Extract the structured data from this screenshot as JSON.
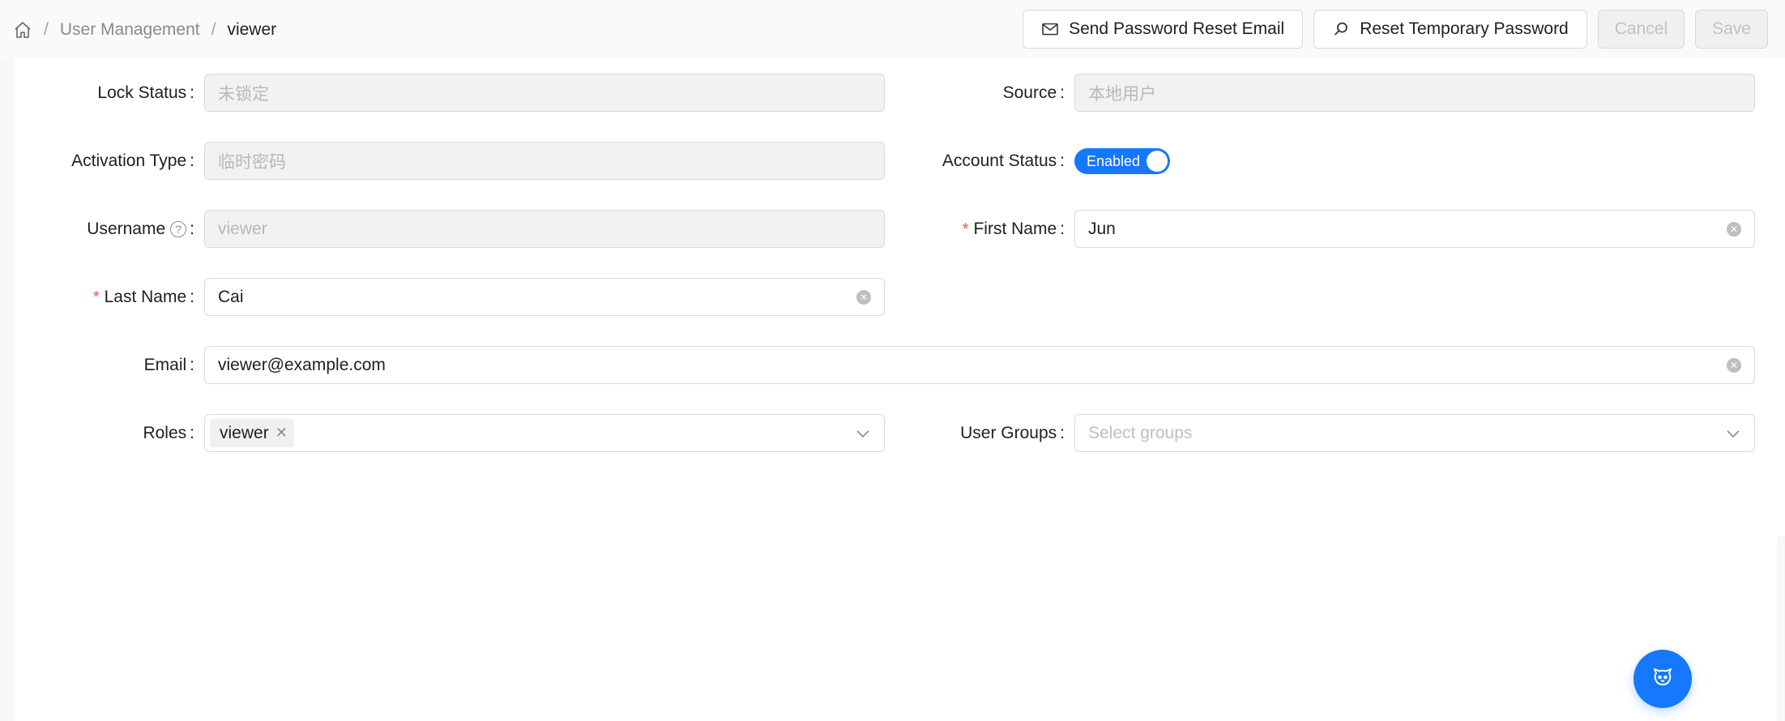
{
  "breadcrumb": {
    "items": [
      "User Management",
      "viewer"
    ]
  },
  "toolbar": {
    "send_reset_label": "Send Password Reset Email",
    "reset_temp_label": "Reset Temporary Password",
    "cancel_label": "Cancel",
    "save_label": "Save"
  },
  "form": {
    "lock_status": {
      "label": "Lock Status",
      "value": "未锁定"
    },
    "source": {
      "label": "Source",
      "value": "本地用户"
    },
    "activation_type": {
      "label": "Activation Type",
      "value": "临时密码"
    },
    "account_status": {
      "label": "Account Status",
      "value": "Enabled"
    },
    "username": {
      "label": "Username",
      "help": "?",
      "value": "viewer"
    },
    "first_name": {
      "label": "First Name",
      "value": "Jun",
      "required_mark": "*"
    },
    "last_name": {
      "label": "Last Name",
      "value": "Cai",
      "required_mark": "*"
    },
    "email": {
      "label": "Email",
      "value": "viewer@example.com"
    },
    "roles": {
      "label": "Roles",
      "tags": [
        "viewer"
      ]
    },
    "user_groups": {
      "label": "User Groups",
      "placeholder": "Select groups"
    },
    "colon": ":"
  },
  "colors": {
    "primary": "#1677ff",
    "required": "#ff4d4f",
    "disabled_bg": "#f2f2f2",
    "border": "#d9d9d9"
  },
  "icons": [
    "home-icon",
    "mail-icon",
    "search-icon",
    "help-icon",
    "clear-icon",
    "chevron-down-icon",
    "close-icon",
    "bot-icon"
  ]
}
